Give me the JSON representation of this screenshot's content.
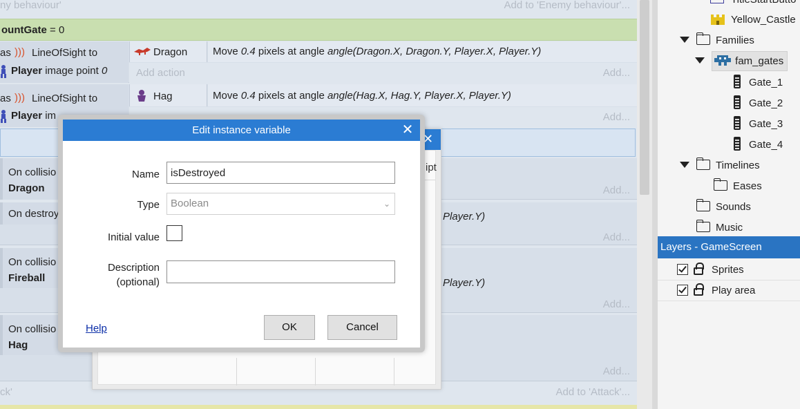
{
  "event_sheet": {
    "top_faint_left": "ny behaviour'",
    "top_faint_right": "Add to 'Enemy behaviour'...",
    "green_row_var": "ountGate",
    "green_row_eq": " = 0",
    "events": [
      {
        "cond_prefix": "as",
        "cond_name": "LineOfSight to",
        "cond_target": "Player",
        "cond_detail": " image point ",
        "cond_value": "0",
        "act_object": "Dragon",
        "act_text_plain": "Move ",
        "act_text_num": "0.4",
        "act_text_mid": " pixels at angle ",
        "act_text_expr": "angle(Dragon.X, Dragon.Y, Player.X, Player.Y)",
        "add_action": "Add action",
        "add_more": "Add..."
      },
      {
        "cond_prefix": "as",
        "cond_name": "LineOfSight to",
        "cond_target": "Player",
        "cond_detail": " im",
        "act_object": "Hag",
        "act_text_plain": "Move ",
        "act_text_num": "0.4",
        "act_text_mid": " pixels at angle ",
        "act_text_expr": "angle(Hag.X, Hag.Y, Player.X, Player.Y)",
        "add_more": "Add..."
      }
    ],
    "collision_dragon": {
      "title": "On collisio",
      "target": "Dragon",
      "add_more": "Add..."
    },
    "destroyed": {
      "title": "On destroy",
      "expr_tail": "Player.Y)",
      "add_more": "Add..."
    },
    "collision_fireball": {
      "title": "On collisio",
      "target": "Fireball",
      "expr_tail": "Player.Y)",
      "add_more": "Add..."
    },
    "collision_hag": {
      "title": "On collisio",
      "target": "Hag",
      "add_more": "Add..."
    },
    "bottom_faint_left": "ck'",
    "bottom_faint_right": "Add to 'Attack'...",
    "bg_dialog_partial_tab": "ipt"
  },
  "project_tree": {
    "items_top": [
      {
        "label": "TitleStartButto",
        "kind": "sprite"
      },
      {
        "label": "Yellow_Castle",
        "kind": "sprite"
      }
    ],
    "families": "Families",
    "fam_gates": "fam_gates",
    "gates": [
      "Gate_1",
      "Gate_2",
      "Gate_3",
      "Gate_4"
    ],
    "timelines": "Timelines",
    "eases": "Eases",
    "sounds": "Sounds",
    "music": "Music"
  },
  "layers": {
    "header": "Layers - GameScreen",
    "items": [
      "Sprites",
      "Play area"
    ]
  },
  "dialog": {
    "title": "Edit instance variable",
    "close_glyph": "✕",
    "name_label": "Name",
    "name_value": "isDestroyed",
    "type_label": "Type",
    "type_value": "Boolean",
    "initial_label": "Initial value",
    "desc_label_1": "Description",
    "desc_label_2": "(optional)",
    "desc_value": "",
    "help": "Help",
    "ok": "OK",
    "cancel": "Cancel"
  },
  "colors": {
    "accent": "#2b7cd3",
    "layers_header": "#2a74c2",
    "event_green": "#c9dfb0"
  }
}
